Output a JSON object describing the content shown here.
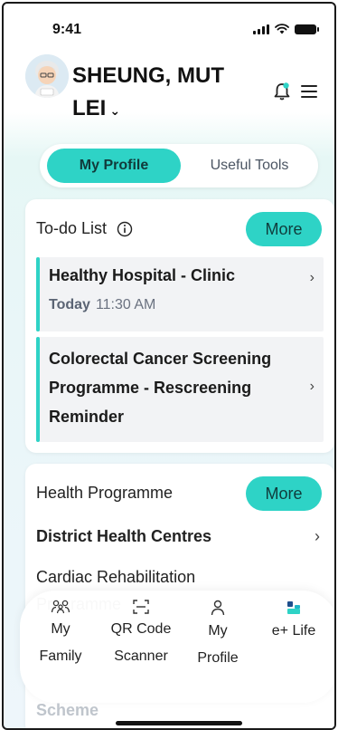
{
  "status_bar": {
    "time": "9:41"
  },
  "header": {
    "name_line1": "SHEUNG, MUT",
    "name_line2": "LEI"
  },
  "segmented": {
    "active": "My Profile",
    "inactive": "Useful Tools"
  },
  "todo": {
    "title": "To-do List",
    "more": "More",
    "items": [
      {
        "title": "Healthy Hospital - Clinic",
        "day": "Today",
        "time": "11:30 AM"
      },
      {
        "title": "Colorectal Cancer Screening Programme - Rescreening Reminder"
      }
    ]
  },
  "health_programme": {
    "title": "Health Programme",
    "more": "More",
    "rows": [
      "District Health Centres",
      "Cardiac Rehabilitation Programme"
    ],
    "partial": "Scheme"
  },
  "nav": {
    "items": [
      {
        "label": "My Family",
        "icon": "family-icon"
      },
      {
        "label": "QR Code Scanner",
        "icon": "qr-scan-icon"
      },
      {
        "label": "My Profile",
        "icon": "profile-icon"
      },
      {
        "label": "e+ Life",
        "icon": "eplus-life-icon"
      }
    ]
  },
  "colors": {
    "accent": "#2ed3c6"
  }
}
